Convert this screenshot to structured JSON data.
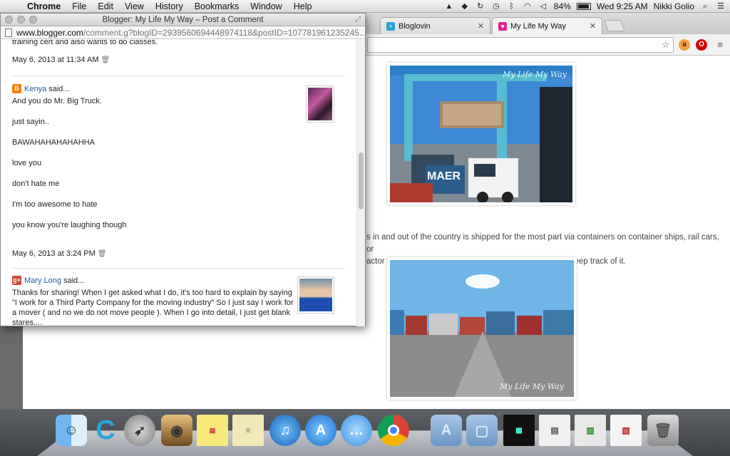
{
  "menubar": {
    "app": "Chrome",
    "items": [
      "File",
      "Edit",
      "View",
      "History",
      "Bookmarks",
      "Window",
      "Help"
    ],
    "battery": "84%",
    "clock": "Wed 9:25 AM",
    "user": "Nikki Golio"
  },
  "tabs": [
    {
      "label": "Bloglovin"
    },
    {
      "label": "My Life My Way"
    }
  ],
  "popup": {
    "title": "Blogger: My Life My Way – Post a Comment",
    "url_host": "www.blogger.com",
    "url_rest": "/comment.g?blogID=2939560694448974118&postID=107781961235245...",
    "cut_text": "training cert and also wants to do classes.",
    "first_timestamp": "May 6, 2013 at 11:34 AM",
    "comments": [
      {
        "author": "Kenya",
        "said": "said...",
        "lines": [
          "And you do Mr. Big Truck.",
          "just sayin..",
          "BAWAHAHAHAHAHHA",
          "love you",
          "don't hate me",
          "I'm too awesome to hate",
          "you know you're laughing though"
        ],
        "timestamp": "May 6, 2013 at 3:24 PM"
      },
      {
        "author": "Mary Long",
        "said": "said...",
        "text": "Thanks for sharing! When I get asked what I do, it's too hard to explain by saying \"I work for a Third Party Company for the moving industry\" So I just say I work for a mover ( and no we do not move people ). When I go into detail, I just get blank stares...."
      }
    ]
  },
  "post": {
    "watermark": "My Life My Way",
    "text_line1": "s in and out of the country is shipped for the most part via containers on container ships, rail cars, or",
    "text_line2": "actor trailers. So when a container comes in we have to keep track of it."
  },
  "colors": {
    "link_blue": "#2255aa",
    "blogger_orange": "#f57d00",
    "gplus_red": "#d34836"
  }
}
